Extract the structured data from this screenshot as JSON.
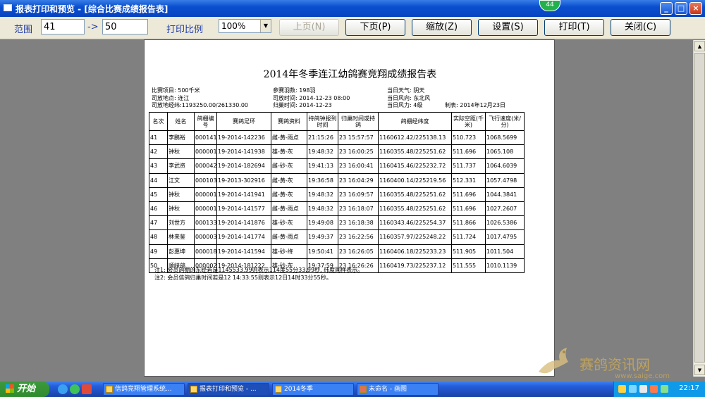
{
  "window": {
    "title": "报表打印和预览 - [综合比赛成绩报告表]",
    "badge": "44",
    "minimize": "_",
    "maximize": "□",
    "close": "×"
  },
  "toolbar": {
    "range_label": "范围",
    "range_from": "41",
    "range_arrow": "->",
    "range_to": "50",
    "scale_label": "打印比例",
    "scale_value": "100%",
    "prev_page": "上页(N)",
    "next_page": "下页(P)",
    "zoom": "缩放(Z)",
    "settings": "设置(S)",
    "print": "打印(T)",
    "close": "关闭(C)"
  },
  "report": {
    "title": "2014年冬季连江幼鸽赛竞翔成绩报告表",
    "info_left": [
      "比赛项目: 500千米",
      "司放地点: 连江",
      "司放地经纬:1193250.00/261330.00"
    ],
    "info_mid": [
      "参赛羽数: 198羽",
      "司放时间: 2014-12-23 08:00",
      "归巢时间: 2014-12-23"
    ],
    "info_right": [
      "当日天气: 阴天",
      "当日风向: 东北风",
      "当日风力: 4级"
    ],
    "made_date": "制表: 2014年12月23日",
    "columns": [
      "名次",
      "姓名",
      "鸽棚编号",
      "赛鸽足环",
      "赛鸽资料",
      "持鸽钟报到时间",
      "归巢时间或持鸽",
      "鸽棚经纬度",
      "实际空距(千米)",
      "飞行速度(米/分)"
    ],
    "rows": [
      [
        "41",
        "李鹏裕",
        "000141",
        "19-2014-142236",
        "雌-黄-雨点",
        "21:15:26",
        "23 15:57:57",
        "1160612.42/225138.13",
        "510.723",
        "1068.5699"
      ],
      [
        "42",
        "钟秋",
        "000001",
        "19-2014-141938",
        "雄-黄-灰",
        "19:48:32",
        "23 16:00:25",
        "1160355.48/225251.62",
        "511.696",
        "1065.108"
      ],
      [
        "43",
        "李武资",
        "000042",
        "19-2014-182694",
        "雌-砂-灰",
        "19:41:13",
        "23 16:00:41",
        "1160415.46/225232.72",
        "511.737",
        "1064.6039"
      ],
      [
        "44",
        "江文",
        "000103",
        "19-2013-302916",
        "雌-黄-灰",
        "19:36:58",
        "23 16:04:29",
        "1160400.14/225219.56",
        "512.331",
        "1057.4798"
      ],
      [
        "45",
        "钟秋",
        "000001",
        "19-2014-141941",
        "雌-黄-灰",
        "19:48:32",
        "23 16:09:57",
        "1160355.48/225251.62",
        "511.696",
        "1044.3841"
      ],
      [
        "46",
        "钟秋",
        "000001",
        "19-2014-141577",
        "雌-黄-雨点",
        "19:48:32",
        "23 16:18:07",
        "1160355.48/225251.62",
        "511.696",
        "1027.2607"
      ],
      [
        "47",
        "刘世方",
        "000133",
        "19-2014-141876",
        "雄-砂-灰",
        "19:49:08",
        "23 16:18:38",
        "1160343.46/225254.37",
        "511.866",
        "1026.5386"
      ],
      [
        "48",
        "林来鉴",
        "000003",
        "19-2014-141774",
        "雌-黄-雨点",
        "19:49:37",
        "23 16:22:56",
        "1160357.97/225248.22",
        "511.724",
        "1017.4795"
      ],
      [
        "49",
        "彭惠坤",
        "000018",
        "19-2014-141594",
        "雄-砂-绛",
        "19:50:41",
        "23 16:26:05",
        "1160406.18/225233.23",
        "511.905",
        "1011.504"
      ],
      [
        "50",
        "顺崃鸽",
        "000002",
        "19-2014-181222",
        "雄-砂-灰",
        "19:37:59",
        "23 16:26:26",
        "1160419.73/225237.12",
        "511.555",
        "1010.1139"
      ]
    ],
    "note1": "注1: 会员鸽棚的东经若是1145533.99则表示114度55分33.99秒, 纬度同样表示。",
    "note2": "注2: 会员信鸽归巢时间若是12 14:33:55则表示12日14时33分55秒。"
  },
  "watermark": {
    "text": "赛鸽资讯网",
    "url": "www.saige.com"
  },
  "taskbar": {
    "start": "开始",
    "tasks": [
      "信鸽竞翔管理系统...",
      "报表打印和预览 - ...",
      "2014冬季",
      "未命名 - 画图"
    ],
    "clock": "22:17"
  },
  "colors": {
    "titlebar": "#0a4fcf",
    "toolbar_bg": "#ece9d8",
    "label_blue": "#1f3aa8",
    "preview_bg": "#808080",
    "taskbar": "#245edb",
    "start": "#3c9a3c"
  }
}
